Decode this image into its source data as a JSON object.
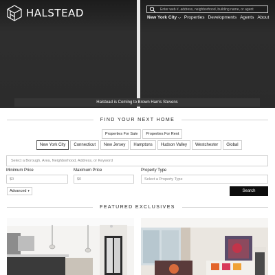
{
  "brand": {
    "name": "HALSTEAD",
    "logo_icon": "halstead-cube-logo"
  },
  "search": {
    "placeholder": "Enter web #, address, neighborhood, building name, or agent",
    "icon": "search-icon"
  },
  "nav": {
    "items": [
      {
        "label": "New York City",
        "active": true,
        "has_dropdown": true
      },
      {
        "label": "Properties"
      },
      {
        "label": "Developments"
      },
      {
        "label": "Agents"
      },
      {
        "label": "About"
      }
    ]
  },
  "hero": {
    "banner": "Halstead is Coming to Brown Harris Stevens"
  },
  "find": {
    "title": "FIND YOUR NEXT HOME",
    "type_tabs": [
      "Properties For Sale",
      "Properties For Rent"
    ],
    "regions": [
      "New York City",
      "Connecticut",
      "New Jersey",
      "Hamptons",
      "Hudson Valley",
      "Westchester",
      "Global"
    ],
    "active_region": "New York City",
    "location_placeholder": "Select a Borough, Area, Neighborhood, Address, or Keyword",
    "min_price_label": "Minimum Price",
    "min_price_placeholder": "$0",
    "max_price_label": "Maximum Price",
    "max_price_placeholder": "$0",
    "property_type_label": "Property Type",
    "property_type_placeholder": "Select a Property Type",
    "advanced_label": "Advanced",
    "search_button": "Search"
  },
  "featured": {
    "title": "FEATURED EXCLUSIVES"
  }
}
